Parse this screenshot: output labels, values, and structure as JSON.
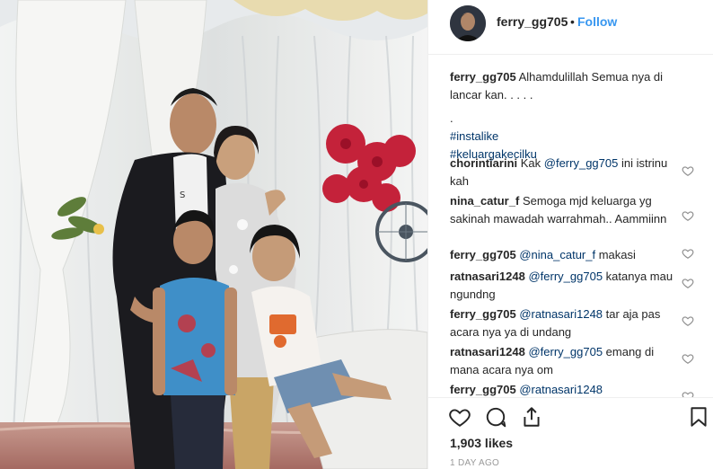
{
  "post": {
    "author": "ferry_gg705",
    "follow_label": "Follow",
    "separator": "•",
    "image_alt": "Family photo of a man, a woman and two children in front of white draped curtains"
  },
  "caption": {
    "user": "ferry_gg705",
    "line1": "Alhamdulillah Semua nya di lancar kan. . . . .",
    "line2": ".",
    "tags": [
      "#instalike",
      "#keluargakecilku"
    ]
  },
  "comments": [
    {
      "user": "chorintiarini",
      "pre": "Kak ",
      "mention": "@ferry_gg705",
      "post": " ini istrinu kah"
    },
    {
      "user": "nina_catur_f",
      "pre": "Semoga mjd keluarga yg sakinah mawadah warrahmah.. Aammiinn",
      "mention": "",
      "post": ""
    },
    {
      "user": "ferry_gg705",
      "pre": "",
      "mention": "@nina_catur_f",
      "post": " makasi"
    },
    {
      "user": "ratnasari1248",
      "pre": "",
      "mention": "@ferry_gg705",
      "post": " katanya mau ngundng"
    },
    {
      "user": "ferry_gg705",
      "pre": "",
      "mention": "@ratnasari1248",
      "post": " tar aja pas acara nya ya di undang"
    },
    {
      "user": "ratnasari1248",
      "pre": "",
      "mention": "@ferry_gg705",
      "post": " emang di mana acara nya om"
    },
    {
      "user": "ferry_gg705",
      "pre": "",
      "mention": "@ratnasari1248",
      "post": ""
    }
  ],
  "footer": {
    "likes": "1,903 likes",
    "time": "1 DAY AGO"
  },
  "icons": {
    "like": "heart-icon",
    "comment": "comment-bubble-icon",
    "share": "share-icon",
    "save": "bookmark-icon",
    "comment_like": "heart-icon"
  },
  "colors": {
    "link": "#003569",
    "follow": "#3897f0",
    "muted": "#999999",
    "text": "#262626"
  }
}
